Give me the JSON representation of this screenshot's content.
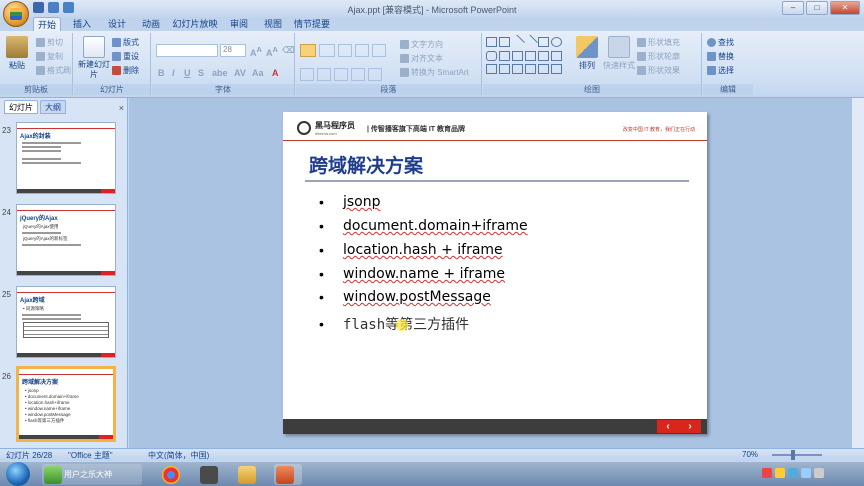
{
  "window": {
    "title": "Ajax.ppt [兼容模式] - Microsoft PowerPoint"
  },
  "ribbon_tabs": [
    "开始",
    "插入",
    "设计",
    "动画",
    "幻灯片放映",
    "审阅",
    "视图",
    "情节提要"
  ],
  "ribbon": {
    "clipboard": {
      "paste": "粘贴",
      "cut": "剪切",
      "copy": "复制",
      "format_painter": "格式刷",
      "label": "剪贴板"
    },
    "slides": {
      "new_slide": "新建幻灯片",
      "layout": "版式",
      "reset": "重设",
      "delete": "删除",
      "label": "幻灯片"
    },
    "font": {
      "size": "28",
      "label": "字体"
    },
    "paragraph": {
      "text_direction": "文字方向",
      "align_text": "对齐文本",
      "smartart": "转换为 SmartArt",
      "label": "段落"
    },
    "drawing": {
      "arrange": "排列",
      "quick_styles": "快速样式",
      "fill": "形状填充",
      "outline": "形状轮廓",
      "effects": "形状效果",
      "label": "绘图"
    },
    "editing": {
      "find": "查找",
      "replace": "替换",
      "select": "选择",
      "label": "编辑"
    }
  },
  "left_panel": {
    "tab_slides": "幻灯片",
    "tab_outline": "大纲",
    "close": "×",
    "thumbnails": [
      {
        "num": "23",
        "title": "Ajax的封装",
        "lines": [
          "Ajax的封装",
          "• Ajax的封装"
        ]
      },
      {
        "num": "24",
        "title": "jQuery的Ajax",
        "lines": [
          "jQuery的Ajax使用",
          "jQuery的Ajax的新标签"
        ]
      },
      {
        "num": "25",
        "title": "Ajax跨域",
        "lines": [
          "• 同源策略"
        ]
      },
      {
        "num": "26",
        "title": "跨域解决方案",
        "lines": [
          "• jsonp",
          "• document.domain+iframe",
          "• location.hash+iframe",
          "• window.name+iframe",
          "• window.postMessage",
          "• flash等第三方插件"
        ]
      }
    ]
  },
  "slide": {
    "brand": "黑马程序员",
    "url": "itheima.com",
    "slogan": "| 传智播客旗下高端 IT 教育品牌",
    "slogan_right": "改变中国 IT 教育，我们正在行动",
    "title": "跨域解决方案",
    "bullets": [
      "jsonp",
      "document.domain+iframe",
      "location.hash + iframe",
      "window.name + iframe",
      "window.postMessage",
      "flash等第三方插件"
    ],
    "bullet_char": "•",
    "nav_prev": "‹",
    "nav_next": "›"
  },
  "statusbar": {
    "slide_pos": "幻灯片 26/28",
    "theme": "\"Office 主题\"",
    "language": "中文(简体，中国)",
    "zoom": "70%"
  },
  "taskbar": {
    "app1": "用户之乐大神"
  },
  "colors": {
    "slide_title": "#1f3d8c",
    "footer_red": "#d9261c",
    "ribbon_blue": "#15428b"
  }
}
